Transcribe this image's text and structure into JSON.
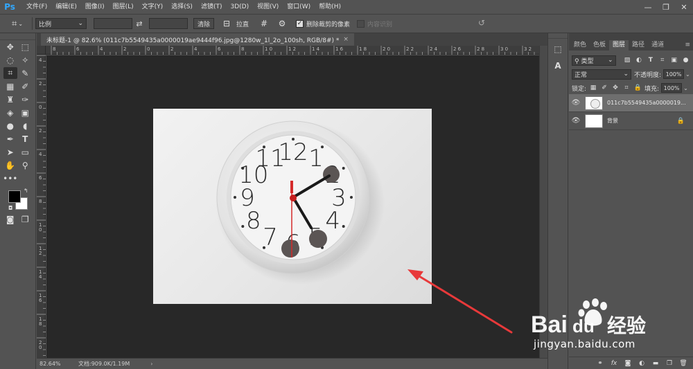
{
  "app": {
    "logo": "Ps",
    "menu": [
      "文件(F)",
      "编辑(E)",
      "图像(I)",
      "图层(L)",
      "文字(Y)",
      "选择(S)",
      "滤镜(T)",
      "3D(D)",
      "视图(V)",
      "窗口(W)",
      "帮助(H)"
    ],
    "window_controls": [
      "—",
      "❐",
      "✕"
    ]
  },
  "options": {
    "ratio_label": "比例",
    "clear_label": "清除",
    "straighten_label": "拉直",
    "delete_cropped_label": "删除裁剪的像素",
    "delete_cropped_checked": true,
    "content_aware_label": "内容识别",
    "content_aware_checked": false
  },
  "document": {
    "tab_title": "未标题-1 @ 82.6% (011c7b5549435a0000019ae9444f96.jpg@1280w_1l_2o_100sh, RGB/8#) *",
    "close": "×"
  },
  "rulers": {
    "h_labels": [
      "8",
      "6",
      "4",
      "2",
      "0",
      "2",
      "4",
      "6",
      "8",
      "1 0",
      "1 2",
      "1 4",
      "1 6",
      "1 8",
      "2 0",
      "2 2",
      "2 4",
      "2 6",
      "2 8",
      "3 0",
      "3 2"
    ],
    "v_labels": [
      "4",
      "2",
      "0",
      "2",
      "4",
      "6",
      "8",
      "1 0",
      "1 2",
      "1 4",
      "1 6",
      "1 8",
      "2 0",
      "2 2"
    ]
  },
  "status": {
    "zoom": "82.64%",
    "doc_info": "文档:909.0K/1.19M",
    "arrow": "›"
  },
  "layers_panel": {
    "tabs": [
      "颜色",
      "色板",
      "图层",
      "路径",
      "通道"
    ],
    "active_tab": "图层",
    "filter_kind": "类型",
    "blend_mode": "正常",
    "opacity_label": "不透明度:",
    "opacity_value": "100%",
    "lock_label": "锁定:",
    "fill_label": "填充:",
    "fill_value": "100%",
    "layers": [
      {
        "name": "011c7b5549435a0000019...",
        "selected": true,
        "locked": false
      },
      {
        "name": "背景",
        "selected": false,
        "locked": true
      }
    ]
  },
  "clock": {
    "numerals": [
      "12",
      "1",
      "2",
      "3",
      "4",
      "5",
      "6",
      "7",
      "8",
      "9",
      "10",
      "11"
    ]
  },
  "watermark": {
    "site": "jingyan.baidu.com"
  },
  "colors": {
    "ui_bg": "#535353",
    "canvas_bg": "#282828",
    "ps_blue": "#31a8ff",
    "annotation_red": "#e8393a"
  }
}
